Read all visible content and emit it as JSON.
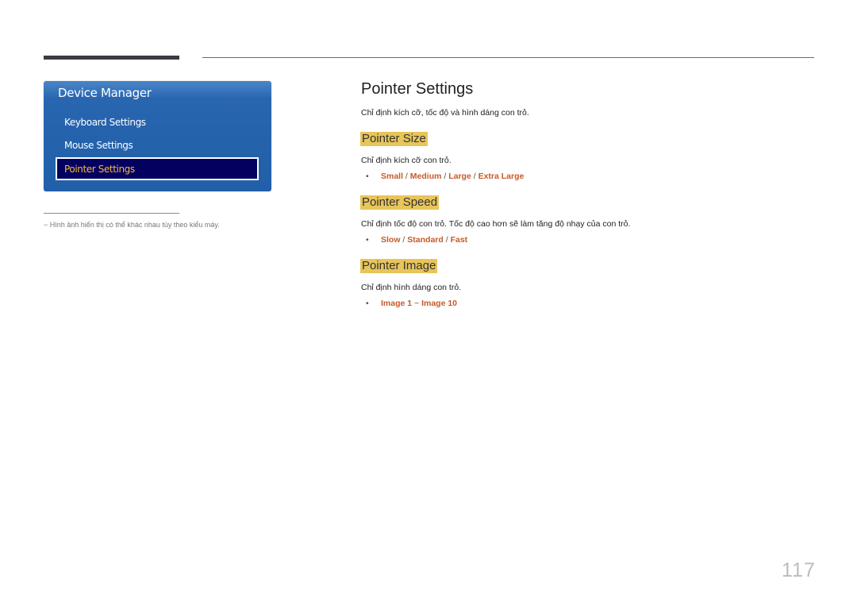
{
  "sidebar": {
    "title": "Device Manager",
    "items": [
      {
        "label": "Keyboard Settings",
        "selected": false
      },
      {
        "label": "Mouse Settings",
        "selected": false
      },
      {
        "label": "Pointer Settings",
        "selected": true
      }
    ],
    "footnote": "−  Hình ảnh hiển thị có thể khác nhau tùy theo kiểu máy."
  },
  "main": {
    "title": "Pointer Settings",
    "description": "Chỉ định kích cỡ, tốc độ và hình dáng con trỏ.",
    "sections": [
      {
        "heading": "Pointer Size",
        "description": "Chỉ định kích cỡ con trỏ.",
        "bullet": "•",
        "options": [
          "Small",
          "Medium",
          "Large",
          "Extra Large"
        ],
        "separator": " / "
      },
      {
        "heading": "Pointer Speed",
        "description": "Chỉ định tốc độ con trỏ. Tốc độ cao hơn sẽ làm tăng độ nhạy của con trỏ.",
        "bullet": "•",
        "options": [
          "Slow",
          "Standard",
          "Fast"
        ],
        "separator": " / "
      },
      {
        "heading": "Pointer Image",
        "description": "Chỉ định hình dáng con trỏ.",
        "bullet": "•",
        "options": [
          "Image 1",
          "Image 10"
        ],
        "separator": " ~ "
      }
    ]
  },
  "page_number": "117",
  "colors": {
    "panel_blue": "#2563ad",
    "selected_bg": "#03005f",
    "selected_text": "#f7b93a",
    "heading_highlight": "#e8c55a",
    "option_text": "#c75a27"
  }
}
